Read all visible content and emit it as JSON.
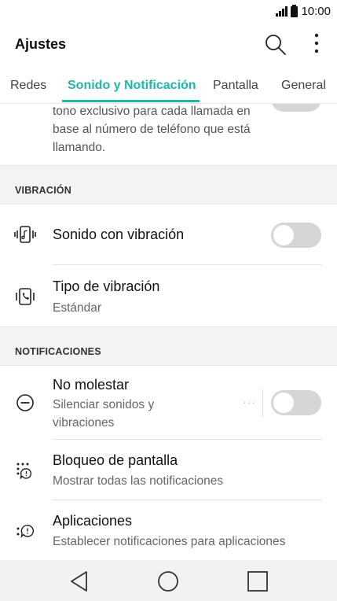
{
  "status_bar": {
    "time": "10:00",
    "signal_icon": "signal-icon",
    "battery_icon": "battery-icon"
  },
  "app_bar": {
    "title": "Ajustes",
    "search_icon": "search-icon",
    "more_icon": "more-vert-icon"
  },
  "tabs": [
    {
      "label": "Redes",
      "active": false
    },
    {
      "label": "Sonido y Notificación",
      "active": true
    },
    {
      "label": "Pantalla",
      "active": false
    },
    {
      "label": "General",
      "active": false
    }
  ],
  "partial_item": {
    "text": "tono exclusivo para cada llamada en base al número de teléfono que está llamando."
  },
  "sections": {
    "vibration": {
      "header": "VIBRACIÓN",
      "items": [
        {
          "title": "Sonido con vibración",
          "icon": "vibrate-music-icon",
          "toggle": false
        },
        {
          "title": "Tipo de vibración",
          "subtitle": "Estándar",
          "icon": "vibrate-phone-icon"
        }
      ]
    },
    "notifications": {
      "header": "NOTIFICACIONES",
      "items": [
        {
          "title": "No molestar",
          "subtitle": "Silenciar sonidos y vibraciones",
          "icon": "do-not-disturb-icon",
          "toggle": false
        },
        {
          "title": "Bloqueo de pantalla",
          "subtitle": "Mostrar todas las notificaciones",
          "icon": "lock-screen-notification-icon"
        },
        {
          "title": "Aplicaciones",
          "subtitle": "Establecer notificaciones para aplicaciones",
          "icon": "app-notification-icon"
        }
      ]
    }
  },
  "nav_bar": {
    "back_icon": "back-icon",
    "home_icon": "home-icon",
    "recents_icon": "recents-icon"
  },
  "colors": {
    "accent": "#22b5a6",
    "toggle_off": "#d6d6d6",
    "section_bg": "#f3f3f3"
  }
}
